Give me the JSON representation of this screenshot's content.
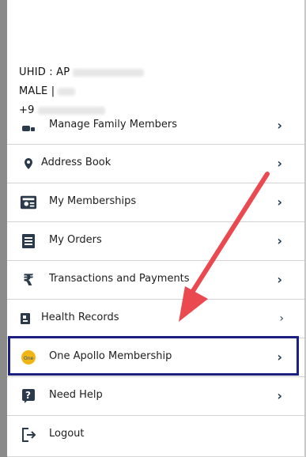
{
  "profile": {
    "uhid_label": "UHID : AP",
    "gender": "MALE |",
    "phone_prefix": "+9"
  },
  "menu": {
    "items": [
      {
        "label": "Manage Family Members",
        "icon": "family-icon"
      },
      {
        "label": "Address Book",
        "icon": "location-pin-icon"
      },
      {
        "label": "My Memberships",
        "icon": "membership-icon"
      },
      {
        "label": "My Orders",
        "icon": "orders-icon"
      },
      {
        "label": "Transactions and Payments",
        "icon": "rupee-icon"
      },
      {
        "label": "Health Records",
        "icon": "health-records-icon"
      },
      {
        "label": "One Apollo Membership",
        "icon": "apollo-logo-icon"
      },
      {
        "label": "Need Help",
        "icon": "help-icon"
      },
      {
        "label": "Logout",
        "icon": "logout-icon"
      }
    ],
    "chevron": "›"
  },
  "annotation": {
    "highlight_color": "#1b1f80",
    "arrow_color": "#e9494f"
  }
}
